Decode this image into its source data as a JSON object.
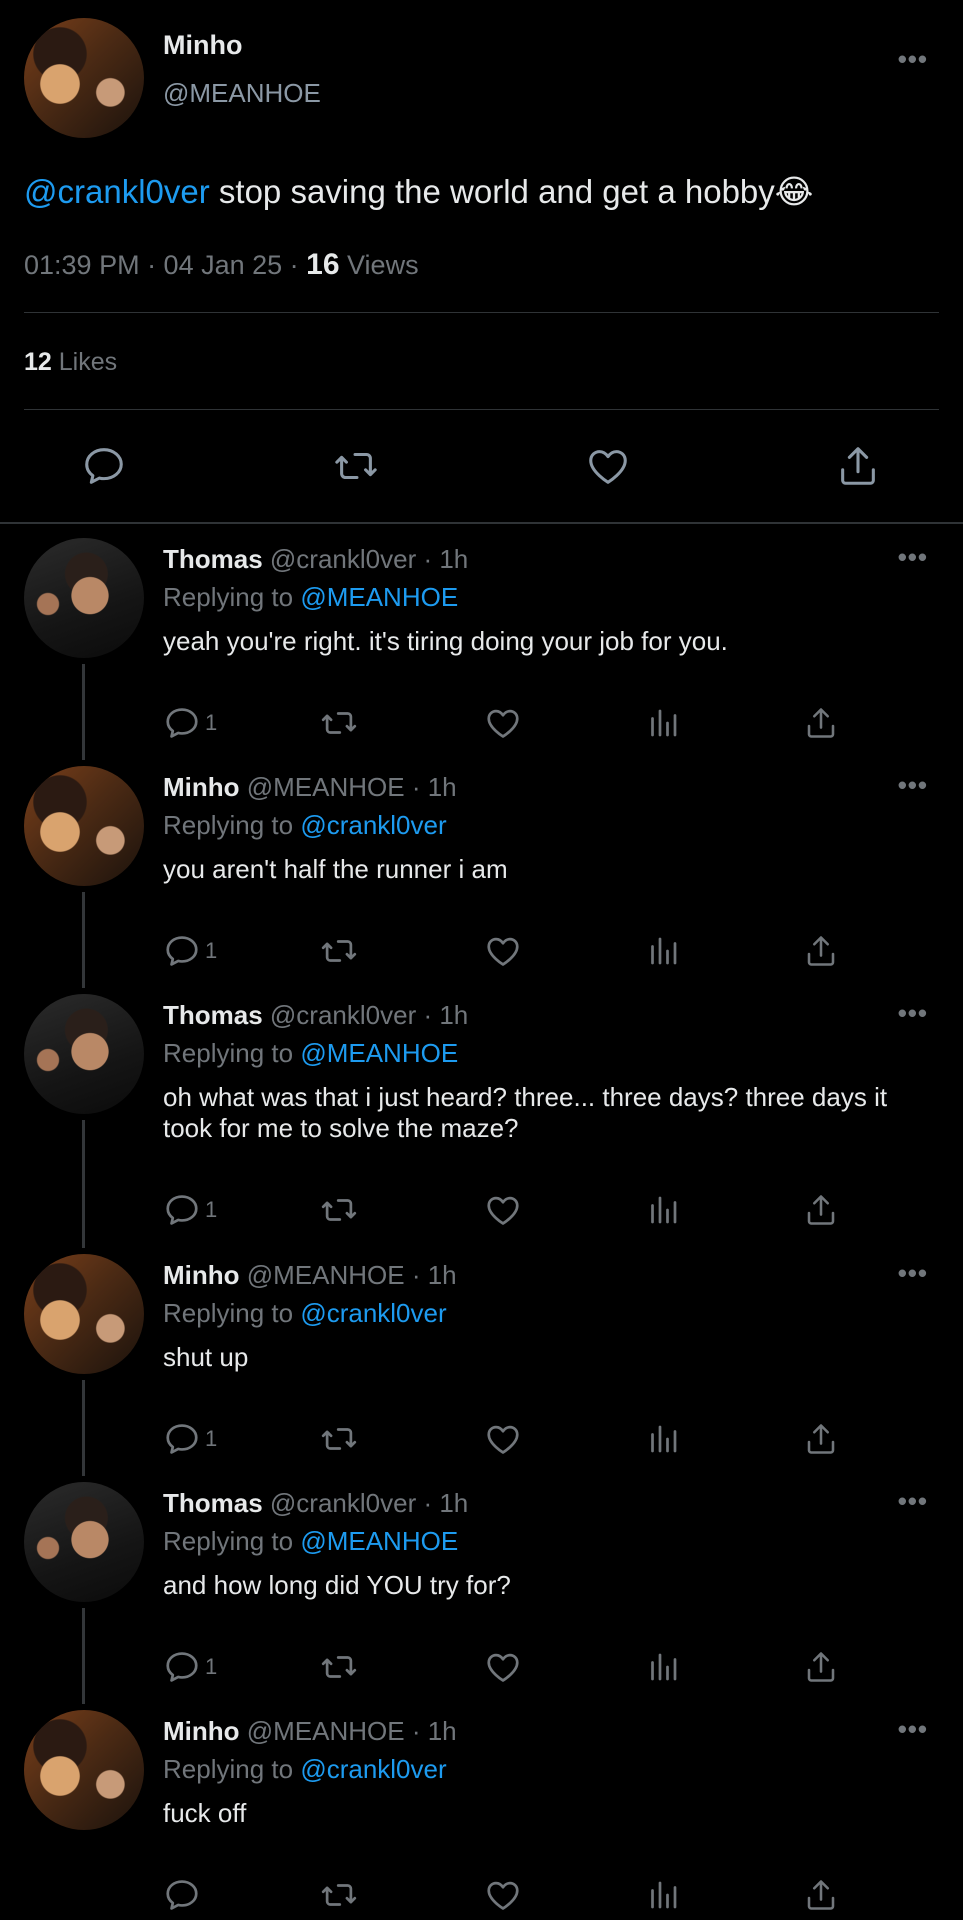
{
  "main": {
    "name": "Minho",
    "handle": "@MEANHOE",
    "mention": "@crankl0ver",
    "text": " stop saving the world and get a hobby😂",
    "time": "01:39 PM · 04 Jan 25 · ",
    "views_count": "16",
    "views_label": " Views",
    "likes_count": "12",
    "likes_label": " Likes",
    "more": "•••"
  },
  "replies": [
    {
      "name": "Thomas",
      "meta": " @crankl0ver · 1h",
      "replying_prefix": "Replying to ",
      "replying_to": "@MEANHOE",
      "text": "yeah you're right. it's tiring doing your job for you.",
      "reply_count": "1",
      "avatar": "thomas"
    },
    {
      "name": "Minho",
      "meta": " @MEANHOE · 1h",
      "replying_prefix": "Replying to ",
      "replying_to": "@crankl0ver",
      "text": "you aren't half the runner i am",
      "reply_count": "1",
      "avatar": "minho"
    },
    {
      "name": "Thomas",
      "meta": " @crankl0ver · 1h",
      "replying_prefix": "Replying to ",
      "replying_to": "@MEANHOE",
      "text": "oh what was that i just heard? three... three days? three days it took for me to solve the maze?",
      "reply_count": "1",
      "avatar": "thomas"
    },
    {
      "name": "Minho",
      "meta": " @MEANHOE · 1h",
      "replying_prefix": "Replying to ",
      "replying_to": "@crankl0ver",
      "text": "shut up",
      "reply_count": "1",
      "avatar": "minho"
    },
    {
      "name": "Thomas",
      "meta": " @crankl0ver · 1h",
      "replying_prefix": "Replying to ",
      "replying_to": "@MEANHOE",
      "text": "and how long did YOU try for?",
      "reply_count": "1",
      "avatar": "thomas"
    },
    {
      "name": "Minho",
      "meta": " @MEANHOE · 1h",
      "replying_prefix": "Replying to ",
      "replying_to": "@crankl0ver",
      "text": "fuck off",
      "reply_count": "",
      "avatar": "minho"
    }
  ],
  "icons": [
    "reply-icon",
    "retweet-icon",
    "like-icon",
    "views-icon",
    "share-icon",
    "more-icon"
  ],
  "colors": {
    "background": "#000000",
    "link": "#1d9bf0",
    "muted": "#71767b",
    "text": "#e7e9ea",
    "divider": "#2f3336"
  }
}
